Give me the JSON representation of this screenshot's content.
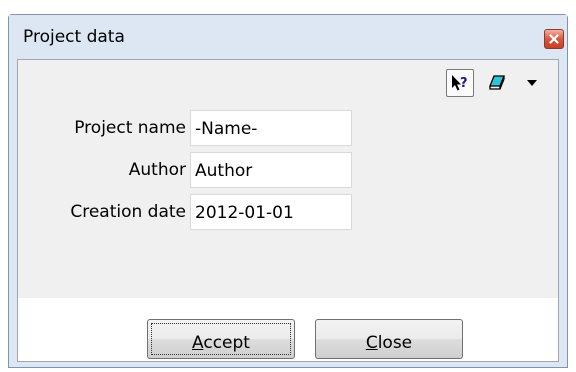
{
  "window": {
    "title": "Project data"
  },
  "toolbar": {
    "help_icon": "context-help-icon",
    "eraser_icon": "eraser-icon",
    "menu_icon": "dropdown-arrow-icon"
  },
  "fields": [
    {
      "label": "Project name",
      "value": "-Name-"
    },
    {
      "label": "Author",
      "value": "Author"
    },
    {
      "label": "Creation date",
      "value": "2012-01-01"
    }
  ],
  "buttons": {
    "accept": {
      "underlined": "A",
      "rest": "ccept"
    },
    "close": {
      "underlined": "C",
      "rest": "lose"
    }
  },
  "colors": {
    "frame": "#dce7f3",
    "client": "#f0f0f0",
    "close_button": "#c7412a",
    "eraser": "#2ec4d6"
  }
}
